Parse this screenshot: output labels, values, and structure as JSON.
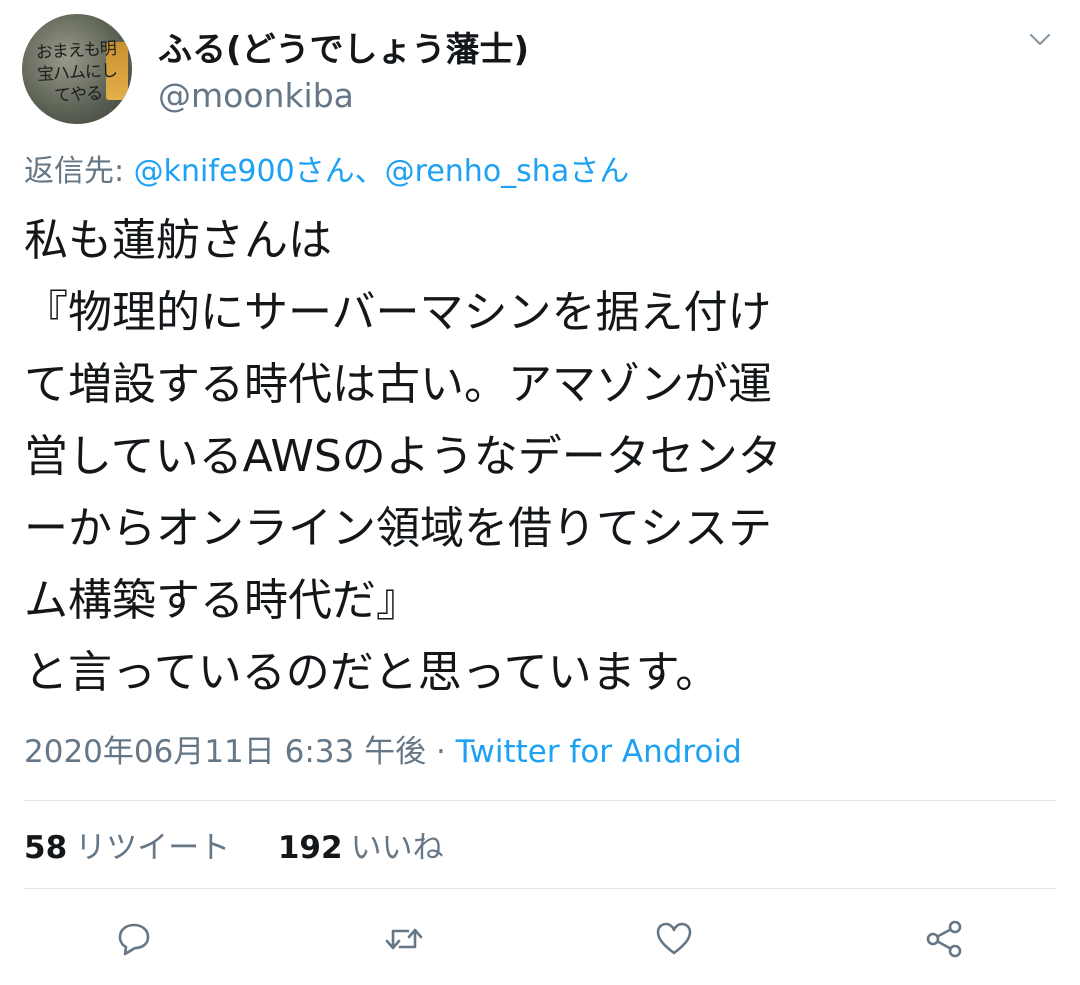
{
  "user": {
    "display_name": "ふる(どうでしょう藩士)",
    "handle": "@moonkiba",
    "avatar_text": "おまえも明宝ハムにしてやる"
  },
  "reply": {
    "prefix": "返信先:",
    "mentions": "@knife900さん、@renho_shaさん"
  },
  "tweet": {
    "text": "私も蓮舫さんは\n『物理的にサーバーマシンを据え付け\nて増設する時代は古い。アマゾンが運\n営しているAWSのようなデータセンタ\nーからオンライン領域を借りてシステ\nム構築する時代だ』\nと言っているのだと思っています。"
  },
  "meta": {
    "timestamp": "2020年06月11日 6:33 午後",
    "separator": " · ",
    "source": "Twitter for Android"
  },
  "stats": {
    "retweets_count": "58",
    "retweets_label": "リツイート",
    "likes_count": "192",
    "likes_label": "いいね"
  },
  "icons": {
    "reply": "reply-icon",
    "retweet": "retweet-icon",
    "like": "like-icon",
    "share": "share-icon",
    "caret": "chevron-down-icon"
  },
  "colors": {
    "link": "#1da1f2",
    "secondary_text": "#657786",
    "primary_text": "#14171a",
    "icon": "#657786"
  }
}
